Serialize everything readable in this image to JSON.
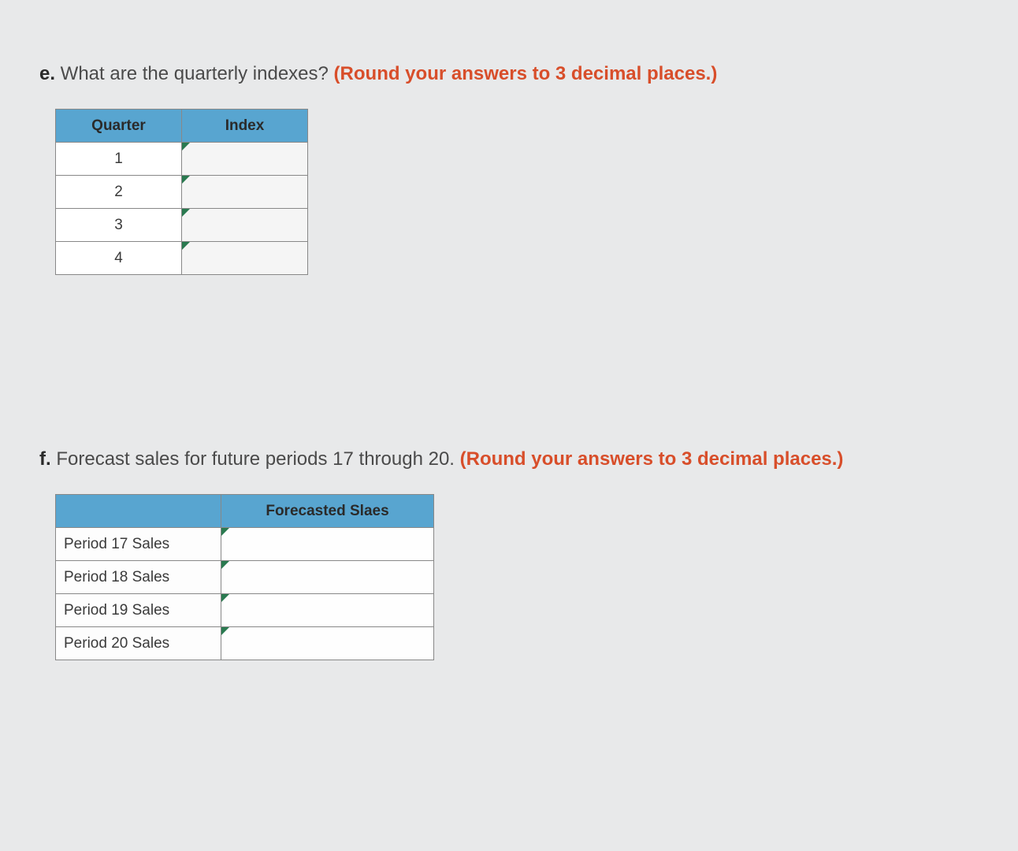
{
  "question_e": {
    "letter": "e.",
    "text": " What are the quarterly indexes? ",
    "instruction": "(Round your answers to 3 decimal places.)",
    "table": {
      "headers": [
        "Quarter",
        "Index"
      ],
      "rows": [
        {
          "quarter": "1",
          "index": ""
        },
        {
          "quarter": "2",
          "index": ""
        },
        {
          "quarter": "3",
          "index": ""
        },
        {
          "quarter": "4",
          "index": ""
        }
      ]
    }
  },
  "question_f": {
    "letter": "f.",
    "text": " Forecast sales for future periods 17 through 20. ",
    "instruction": "(Round your answers to 3 decimal places.)",
    "table": {
      "headers": [
        "",
        "Forecasted Slaes"
      ],
      "rows": [
        {
          "label": "Period 17 Sales",
          "value": ""
        },
        {
          "label": "Period 18 Sales",
          "value": ""
        },
        {
          "label": "Period 19 Sales",
          "value": ""
        },
        {
          "label": "Period 20 Sales",
          "value": ""
        }
      ]
    }
  }
}
